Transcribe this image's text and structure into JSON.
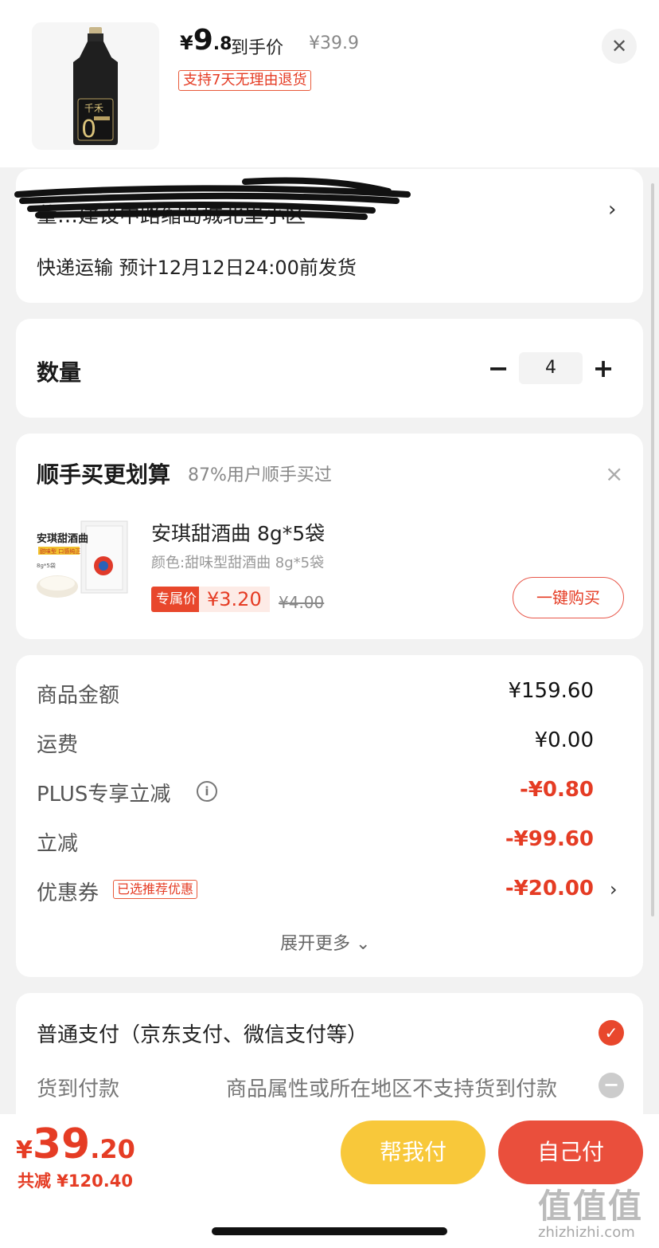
{
  "product": {
    "price_currency": "¥",
    "price_int": "9",
    "price_dec": ".8",
    "price_label": "到手价",
    "original_price": "¥39.9",
    "return_policy": "支持7天无理由退货",
    "bottle_label": "千禾",
    "bottle_zero": "0"
  },
  "address": {
    "line": "董…建设中路缩岛城北里小区",
    "shipping": "快递运输 预计12月12日24:00前发货"
  },
  "quantity": {
    "label": "数量",
    "value": "4",
    "minus": "−",
    "plus": "+"
  },
  "recommend": {
    "title": "顺手买更划算",
    "subtitle": "87%用户顺手买过",
    "item": {
      "name": "安琪甜酒曲 8g*5袋",
      "spec": "颜色:甜味型甜酒曲 8g*5袋",
      "badge": "专属价",
      "price": "¥3.20",
      "original_price": "¥4.00",
      "buy_label": "一键购买",
      "pack_text": "安琪甜酒曲",
      "pack_tag": "甜味型 口感纯正",
      "pack_size": "8g*5袋"
    }
  },
  "summary": {
    "rows": [
      {
        "label": "商品金额",
        "value": "¥159.60"
      },
      {
        "label": "运费",
        "value": "¥0.00"
      },
      {
        "label": "PLUS专享立减",
        "value": "-¥0.80"
      },
      {
        "label": "立减",
        "value": "-¥99.60"
      },
      {
        "label": "优惠券",
        "value": "-¥20.00"
      }
    ],
    "coupon_badge": "已选推荐优惠",
    "expand_label": "展开更多 ⌄"
  },
  "payment": {
    "normal": "普通支付（京东支付、微信支付等）",
    "cod": "货到付款",
    "cod_note": "商品属性或所在地区不支持货到付款"
  },
  "bottom": {
    "total_currency": "¥",
    "total_int": "39",
    "total_dec": ".20",
    "saved": "共减 ¥120.40",
    "help_pay": "帮我付",
    "self_pay": "自己付"
  },
  "watermark": {
    "text": "值值值",
    "url": "zhizhizhi.com"
  },
  "colors": {
    "accent_red": "#e53c24",
    "help_yellow": "#f8c83a",
    "self_red": "#ea4f3c"
  }
}
